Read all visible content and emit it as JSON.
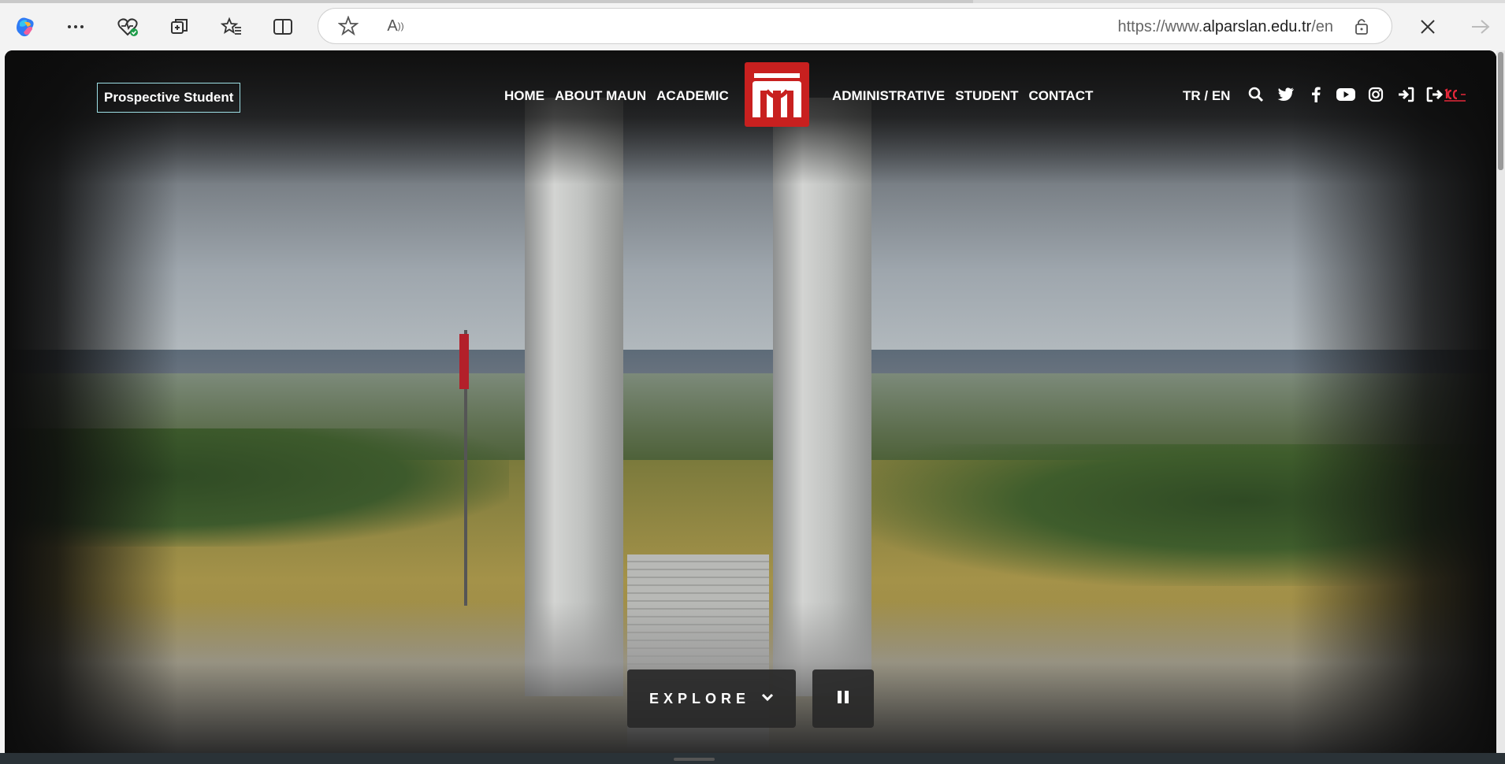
{
  "browser": {
    "url_prefix": "https://www.",
    "url_domain": "alparslan.edu.tr",
    "url_path": "/en",
    "toolbar_icons": [
      "copilot-icon",
      "more-icon",
      "health-icon",
      "collections-icon",
      "favorites-icon",
      "split-screen-icon"
    ],
    "address_icons": [
      "favorite-star-icon",
      "read-aloud-icon",
      "lock-icon"
    ],
    "right_icons": [
      "close-icon",
      "forward-icon"
    ]
  },
  "site": {
    "prospective_label": "Prospective Student",
    "nav_left": [
      "HOME",
      "ABOUT MAUN",
      "ACADEMIC"
    ],
    "nav_right": [
      "ADMINISTRATIVE",
      "STUDENT",
      "CONTACT"
    ],
    "lang": "TR / EN",
    "social_icons": [
      "search-icon",
      "twitter-icon",
      "facebook-icon",
      "youtube-icon",
      "instagram-icon",
      "login-icon",
      "logout-icon"
    ],
    "explore_label": "EXPLORE",
    "brand_color": "#c8201f",
    "accent_border": "#9ee0e6"
  }
}
